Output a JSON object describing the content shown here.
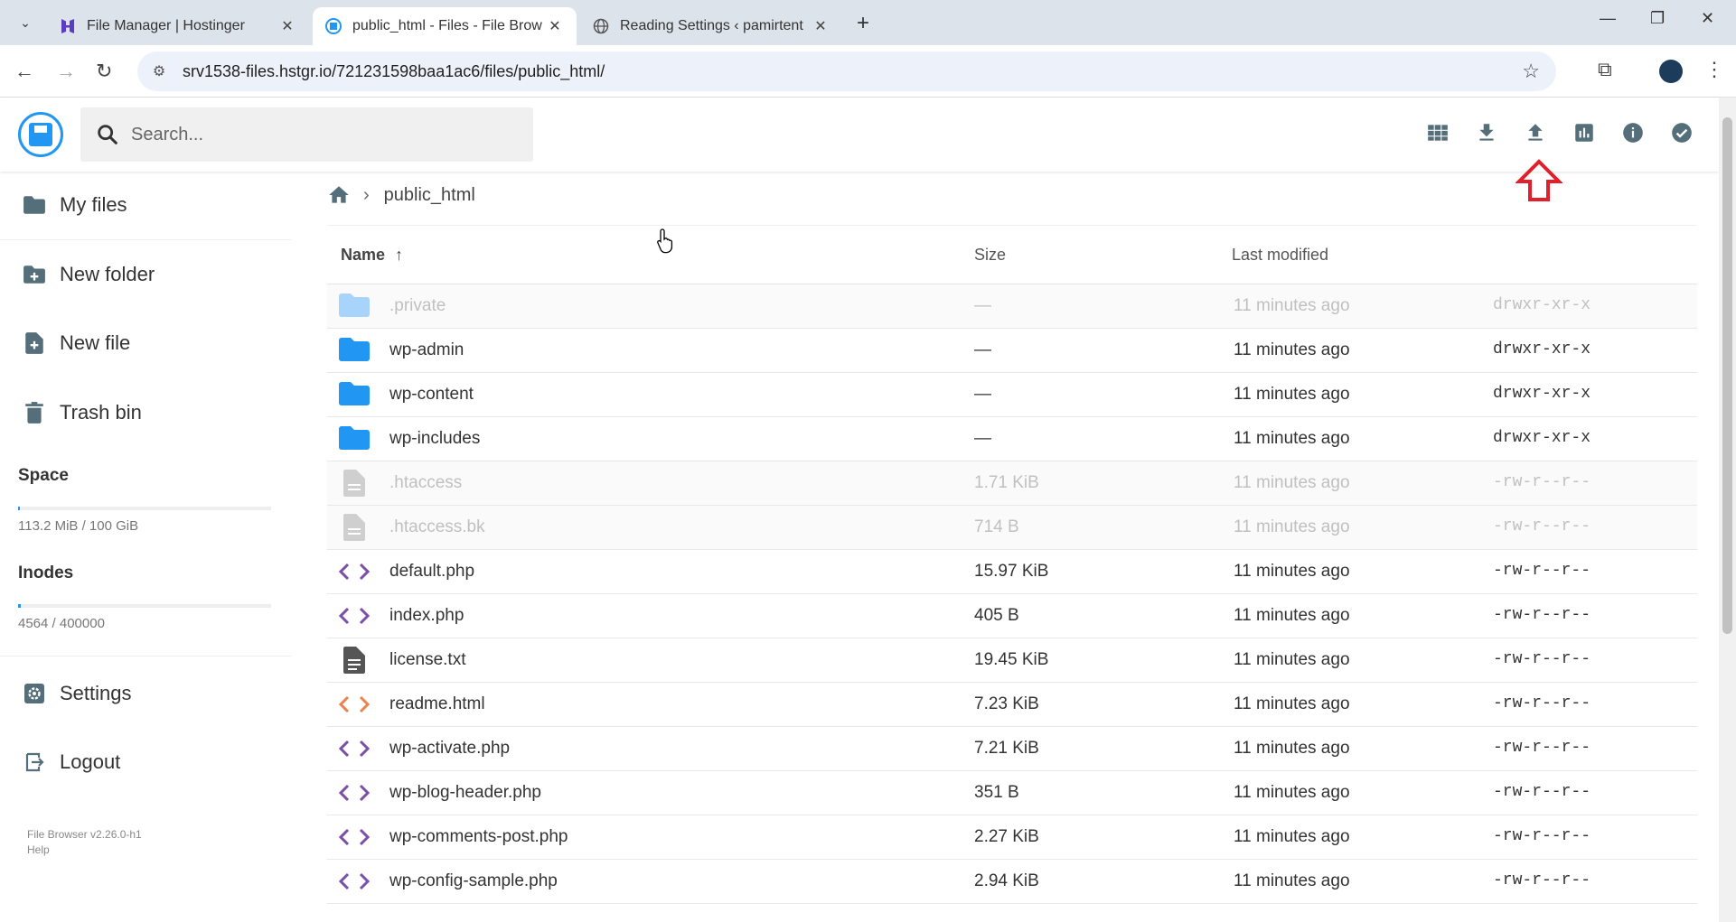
{
  "browser": {
    "tabs": [
      {
        "title": "File Manager | Hostinger",
        "active": false
      },
      {
        "title": "public_html - Files - File Brow",
        "active": true
      },
      {
        "title": "Reading Settings ‹ pamirtent",
        "active": false
      }
    ],
    "url": "srv1538-files.hstgr.io/721231598baa1ac6/files/public_html/"
  },
  "header": {
    "search_placeholder": "Search..."
  },
  "sidebar": {
    "items": [
      {
        "label": "My files",
        "icon": "folder-icon"
      },
      {
        "label": "New folder",
        "icon": "new-folder-icon"
      },
      {
        "label": "New file",
        "icon": "new-file-icon"
      },
      {
        "label": "Trash bin",
        "icon": "trash-icon"
      }
    ],
    "space_label": "Space",
    "space_value": "113.2 MiB / 100 GiB",
    "space_fraction": 0.0011,
    "inodes_label": "Inodes",
    "inodes_value": "4564 / 400000",
    "inodes_fraction": 0.0114,
    "settings_label": "Settings",
    "logout_label": "Logout",
    "version": "File Browser v2.26.0-h1",
    "help": "Help"
  },
  "breadcrumb": {
    "current": "public_html"
  },
  "table": {
    "headers": {
      "name": "Name",
      "size": "Size",
      "modified": "Last modified"
    },
    "rows": [
      {
        "name": ".private",
        "size": "—",
        "modified": "11 minutes ago",
        "perm": "drwxr-xr-x",
        "type": "folder",
        "dim": true
      },
      {
        "name": "wp-admin",
        "size": "—",
        "modified": "11 minutes ago",
        "perm": "drwxr-xr-x",
        "type": "folder",
        "dim": false
      },
      {
        "name": "wp-content",
        "size": "—",
        "modified": "11 minutes ago",
        "perm": "drwxr-xr-x",
        "type": "folder",
        "dim": false
      },
      {
        "name": "wp-includes",
        "size": "—",
        "modified": "11 minutes ago",
        "perm": "drwxr-xr-x",
        "type": "folder",
        "dim": false
      },
      {
        "name": ".htaccess",
        "size": "1.71 KiB",
        "modified": "11 minutes ago",
        "perm": "-rw-r--r--",
        "type": "file",
        "dim": true
      },
      {
        "name": ".htaccess.bk",
        "size": "714 B",
        "modified": "11 minutes ago",
        "perm": "-rw-r--r--",
        "type": "file",
        "dim": true
      },
      {
        "name": "default.php",
        "size": "15.97 KiB",
        "modified": "11 minutes ago",
        "perm": "-rw-r--r--",
        "type": "code",
        "dim": false
      },
      {
        "name": "index.php",
        "size": "405 B",
        "modified": "11 minutes ago",
        "perm": "-rw-r--r--",
        "type": "code",
        "dim": false
      },
      {
        "name": "license.txt",
        "size": "19.45 KiB",
        "modified": "11 minutes ago",
        "perm": "-rw-r--r--",
        "type": "text",
        "dim": false
      },
      {
        "name": "readme.html",
        "size": "7.23 KiB",
        "modified": "11 minutes ago",
        "perm": "-rw-r--r--",
        "type": "html",
        "dim": false
      },
      {
        "name": "wp-activate.php",
        "size": "7.21 KiB",
        "modified": "11 minutes ago",
        "perm": "-rw-r--r--",
        "type": "code",
        "dim": false
      },
      {
        "name": "wp-blog-header.php",
        "size": "351 B",
        "modified": "11 minutes ago",
        "perm": "-rw-r--r--",
        "type": "code",
        "dim": false
      },
      {
        "name": "wp-comments-post.php",
        "size": "2.27 KiB",
        "modified": "11 minutes ago",
        "perm": "-rw-r--r--",
        "type": "code",
        "dim": false
      },
      {
        "name": "wp-config-sample.php",
        "size": "2.94 KiB",
        "modified": "11 minutes ago",
        "perm": "-rw-r--r--",
        "type": "code",
        "dim": false
      }
    ]
  },
  "colors": {
    "accent": "#2196f3",
    "folder": "#2196f3",
    "code": "#7b4fa8",
    "html": "#e8834e",
    "annotation": "#e0202a"
  }
}
